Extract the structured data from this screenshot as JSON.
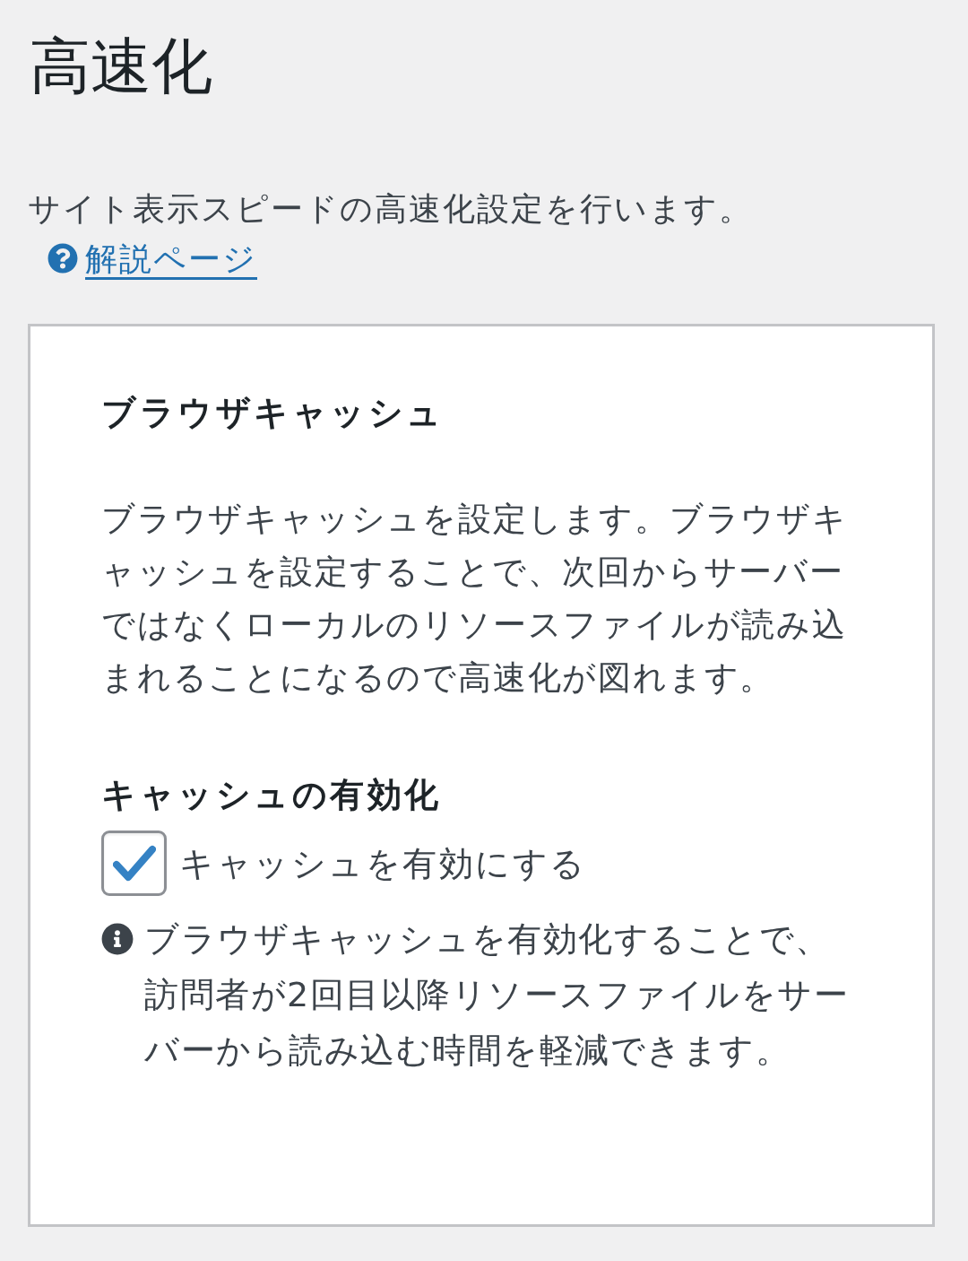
{
  "page": {
    "title": "高速化",
    "description": "サイト表示スピードの高速化設定を行います。",
    "help_link": "解説ページ"
  },
  "section": {
    "title": "ブラウザキャッシュ",
    "description": "ブラウザキャッシュを設定します。ブラウザキャッシュを設定することで、次回からサーバーではなくローカルのリソースファイルが読み込まれることになるので高速化が図れます。",
    "setting": {
      "label": "キャッシュの有効化",
      "checkbox": {
        "label": "キャッシュを有効にする",
        "checked": true
      },
      "note": "ブラウザキャッシュを有効化することで、訪問者が2回目以降リソースファイルをサーバーから読み込む時間を軽減できます。"
    }
  }
}
